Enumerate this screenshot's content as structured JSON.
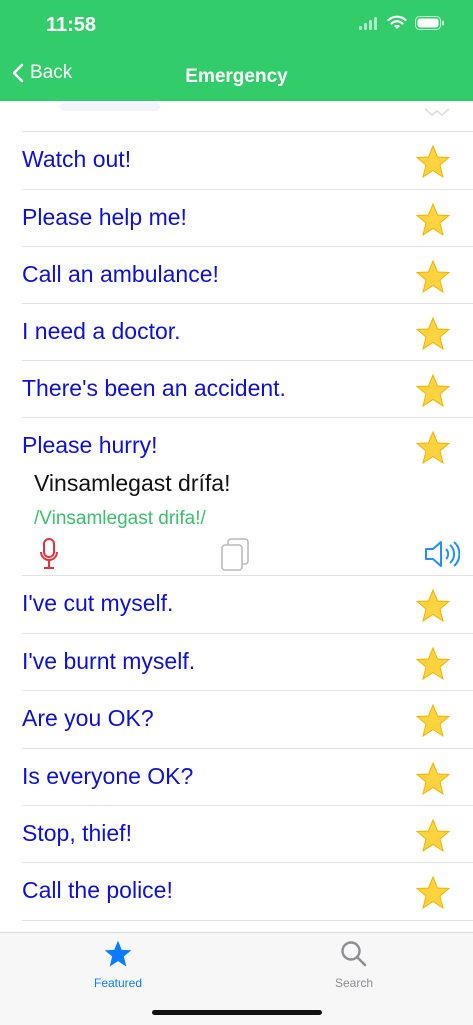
{
  "status": {
    "time": "11:58"
  },
  "nav": {
    "back_label": "Back",
    "title": "Emergency"
  },
  "phrases": [
    {
      "text": "Watch out!"
    },
    {
      "text": "Please help me!"
    },
    {
      "text": "Call an ambulance!"
    },
    {
      "text": "I need a doctor."
    },
    {
      "text": "There's been an accident."
    },
    {
      "text": "Please hurry!",
      "native": "Vinsamlegast drífa!",
      "translit": "/Vinsamlegast drifa!/"
    },
    {
      "text": "I've cut myself."
    },
    {
      "text": "I've burnt myself."
    },
    {
      "text": "Are you OK?"
    },
    {
      "text": "Is everyone OK?"
    },
    {
      "text": "Stop, thief!"
    },
    {
      "text": "Call the police!"
    }
  ],
  "tabs": [
    {
      "label": "Featured",
      "icon": "star-icon",
      "active": true
    },
    {
      "label": "Search",
      "icon": "magnifier-icon",
      "active": false
    }
  ],
  "colors": {
    "header": "#32cd6a",
    "phrase": "#0d10d8",
    "translit": "#39c16b",
    "active_tab": "#0a7cff",
    "mic": "#e8323a",
    "speaker": "#1e90ff"
  }
}
